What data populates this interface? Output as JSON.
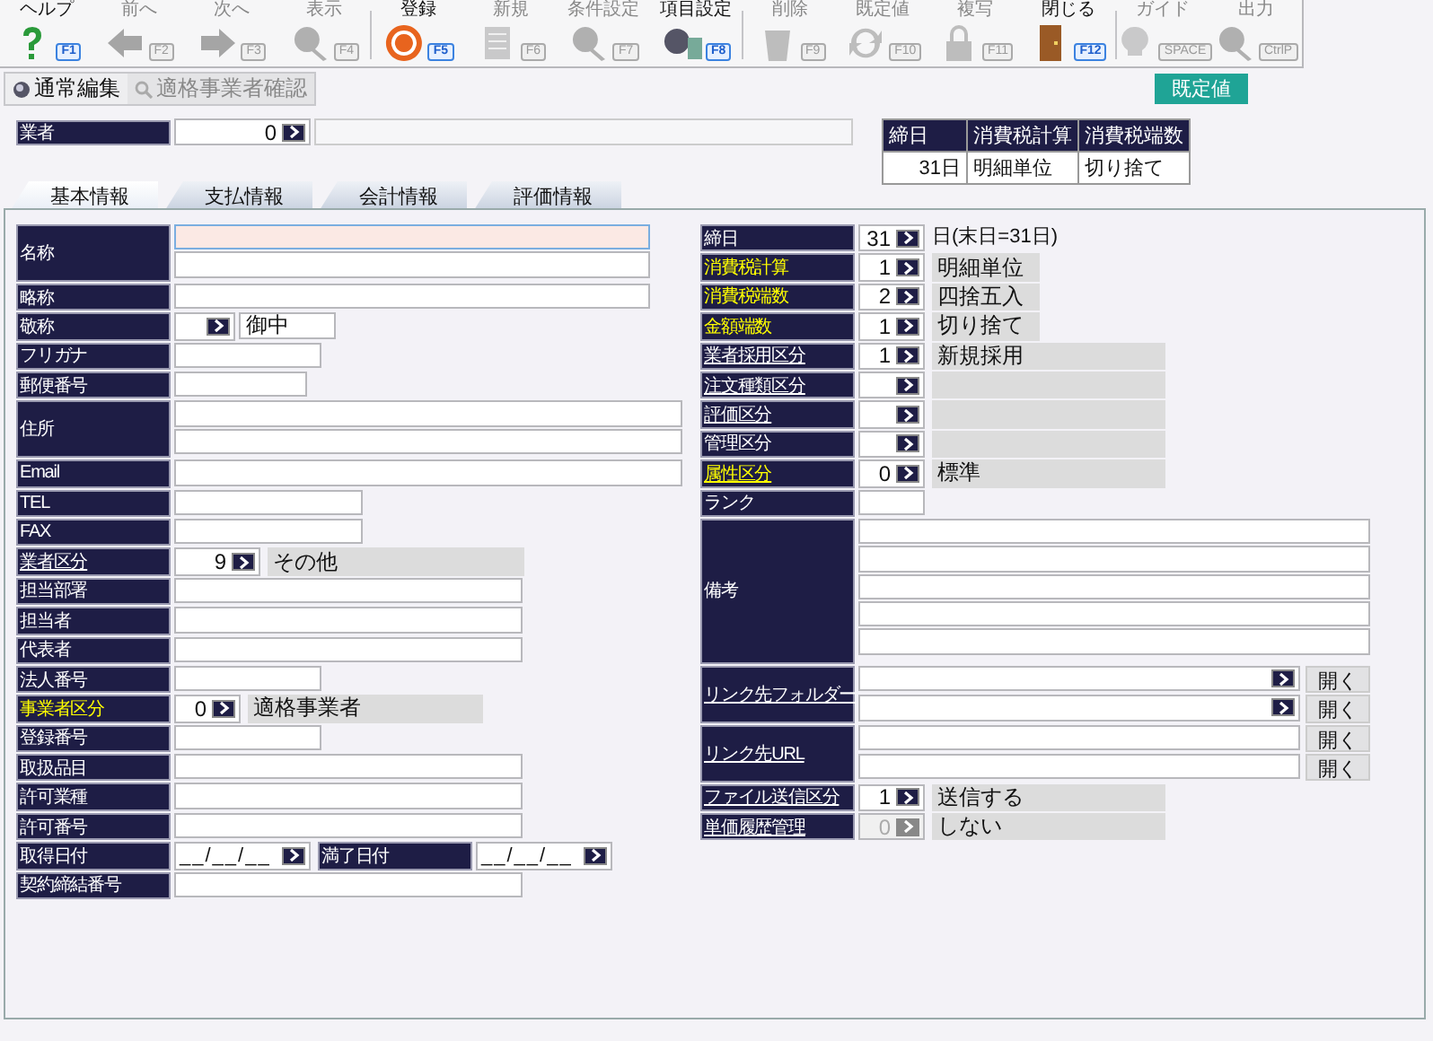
{
  "toolbar": {
    "groups": [
      [
        {
          "label": "ヘルプ",
          "key": "F1",
          "disabled": false
        },
        {
          "label": "前へ",
          "key": "F2",
          "disabled": true
        },
        {
          "label": "次へ",
          "key": "F3",
          "disabled": true
        },
        {
          "label": "表示",
          "key": "F4",
          "disabled": true
        }
      ],
      [
        {
          "label": "登録",
          "key": "F5",
          "disabled": false
        },
        {
          "label": "新規",
          "key": "F6",
          "disabled": true
        },
        {
          "label": "条件設定",
          "key": "F7",
          "disabled": true
        },
        {
          "label": "項目設定",
          "key": "F8",
          "disabled": false
        }
      ],
      [
        {
          "label": "削除",
          "key": "F9",
          "disabled": true
        },
        {
          "label": "既定値",
          "key": "F10",
          "disabled": true
        },
        {
          "label": "複写",
          "key": "F11",
          "disabled": true
        },
        {
          "label": "閉じる",
          "key": "F12",
          "disabled": false
        }
      ],
      [
        {
          "label": "ガイド",
          "key": "SPACE",
          "disabled": true
        },
        {
          "label": "出力",
          "key": "CtrlP",
          "disabled": true
        }
      ]
    ]
  },
  "modes": [
    {
      "label": "通常編集",
      "selected": true
    },
    {
      "label": "適格事業者確認",
      "selected": false
    }
  ],
  "default_button": "既定値",
  "vendor": {
    "label": "業者",
    "code": "0"
  },
  "summary": {
    "columns": [
      "締日",
      "消費税計算",
      "消費税端数"
    ],
    "row": [
      "31日",
      "明細単位",
      "切り捨て"
    ]
  },
  "tabs": [
    {
      "label": "基本情報",
      "selected": true
    },
    {
      "label": "支払情報",
      "selected": false
    },
    {
      "label": "会計情報",
      "selected": false
    },
    {
      "label": "評価情報",
      "selected": false
    }
  ],
  "left_rows": [
    {
      "label": "名称",
      "kind": "text",
      "required": false,
      "link": false,
      "disabled": false
    },
    {
      "label": "略称",
      "kind": "text",
      "required": false,
      "link": false,
      "disabled": false
    },
    {
      "label": "敬称",
      "kind": "code_text",
      "name": "御中",
      "required": false,
      "link": false,
      "disabled": false
    },
    {
      "label": "フリガナ",
      "kind": "text",
      "required": false,
      "link": false,
      "disabled": false
    },
    {
      "label": "郵便番号",
      "kind": "text",
      "required": false,
      "link": false,
      "disabled": false
    },
    {
      "label": "住所",
      "kind": "text",
      "required": false,
      "link": false,
      "disabled": false
    },
    {
      "label": "Email",
      "kind": "text",
      "required": false,
      "link": false,
      "disabled": false
    },
    {
      "label": "TEL",
      "kind": "text",
      "required": false,
      "link": false,
      "disabled": false
    },
    {
      "label": "FAX",
      "kind": "text",
      "required": false,
      "link": false,
      "disabled": false
    },
    {
      "label": "業者区分",
      "kind": "code",
      "code": "9",
      "name": "その他",
      "required": false,
      "link": true,
      "disabled": false
    },
    {
      "label": "担当部署",
      "kind": "text",
      "required": false,
      "link": false,
      "disabled": false
    },
    {
      "label": "担当者",
      "kind": "text",
      "required": false,
      "link": false,
      "disabled": false
    },
    {
      "label": "代表者",
      "kind": "text",
      "required": false,
      "link": false,
      "disabled": false
    },
    {
      "label": "法人番号",
      "kind": "text",
      "required": false,
      "link": false,
      "disabled": false
    },
    {
      "label": "事業者区分",
      "kind": "code",
      "code": "0",
      "name": "適格事業者",
      "required": true,
      "link": false,
      "disabled": false
    },
    {
      "label": "登録番号",
      "kind": "text",
      "required": false,
      "link": false,
      "disabled": false
    },
    {
      "label": "取扱品目",
      "kind": "text",
      "required": false,
      "link": false,
      "disabled": false
    },
    {
      "label": "許可業種",
      "kind": "text",
      "required": false,
      "link": false,
      "disabled": false
    },
    {
      "label": "許可番号",
      "kind": "text",
      "required": false,
      "link": false,
      "disabled": false
    },
    {
      "label": "取得日付",
      "kind": "date",
      "value": "__/__/__",
      "end_label": "満了日付",
      "end_value": "__/__/__",
      "required": false,
      "link": false,
      "disabled": false
    },
    {
      "label": "契約締結番号",
      "kind": "text",
      "required": false,
      "link": false,
      "disabled": false
    }
  ],
  "right_rows": [
    {
      "label": "締日",
      "kind": "code_note",
      "code": "31",
      "note": "日(末日=31日)",
      "required": false,
      "link": false,
      "disabled": false
    },
    {
      "label": "消費税計算",
      "kind": "code",
      "code": "1",
      "name": "明細単位",
      "required": true,
      "link": false,
      "disabled": false
    },
    {
      "label": "消費税端数",
      "kind": "code",
      "code": "2",
      "name": "四捨五入",
      "required": true,
      "link": false,
      "disabled": false
    },
    {
      "label": "金額端数",
      "kind": "code",
      "code": "1",
      "name": "切り捨て",
      "required": true,
      "link": false,
      "disabled": false
    },
    {
      "label": "業者採用区分",
      "kind": "code",
      "code": "1",
      "name": "新規採用",
      "required": false,
      "link": true,
      "disabled": false
    },
    {
      "label": "注文種類区分",
      "kind": "code",
      "required": false,
      "link": true,
      "disabled": false
    },
    {
      "label": "評価区分",
      "kind": "code",
      "required": false,
      "link": true,
      "disabled": false
    },
    {
      "label": "管理区分",
      "kind": "code",
      "required": false,
      "link": false,
      "disabled": false
    },
    {
      "label": "属性区分",
      "kind": "code",
      "code": "0",
      "name": "標準",
      "required": true,
      "link": true,
      "disabled": false
    },
    {
      "label": "ランク",
      "kind": "text",
      "required": false,
      "link": false,
      "disabled": false
    },
    {
      "label": "備考",
      "kind": "text",
      "required": false,
      "link": false,
      "disabled": false
    },
    {
      "label": "リンク先フォルダー",
      "kind": "folder",
      "buttons": [
        "開く",
        "開く"
      ],
      "required": false,
      "link": true,
      "disabled": false
    },
    {
      "label": "リンク先URL",
      "kind": "url",
      "buttons": [
        "開く",
        "開く"
      ],
      "required": false,
      "link": true,
      "disabled": false
    },
    {
      "label": "ファイル送信区分",
      "kind": "code",
      "code": "1",
      "name": "送信する",
      "required": false,
      "link": true,
      "disabled": false
    },
    {
      "label": "単価履歴管理",
      "kind": "code",
      "code": "0",
      "name": "しない",
      "required": false,
      "link": true,
      "disabled": true
    }
  ]
}
